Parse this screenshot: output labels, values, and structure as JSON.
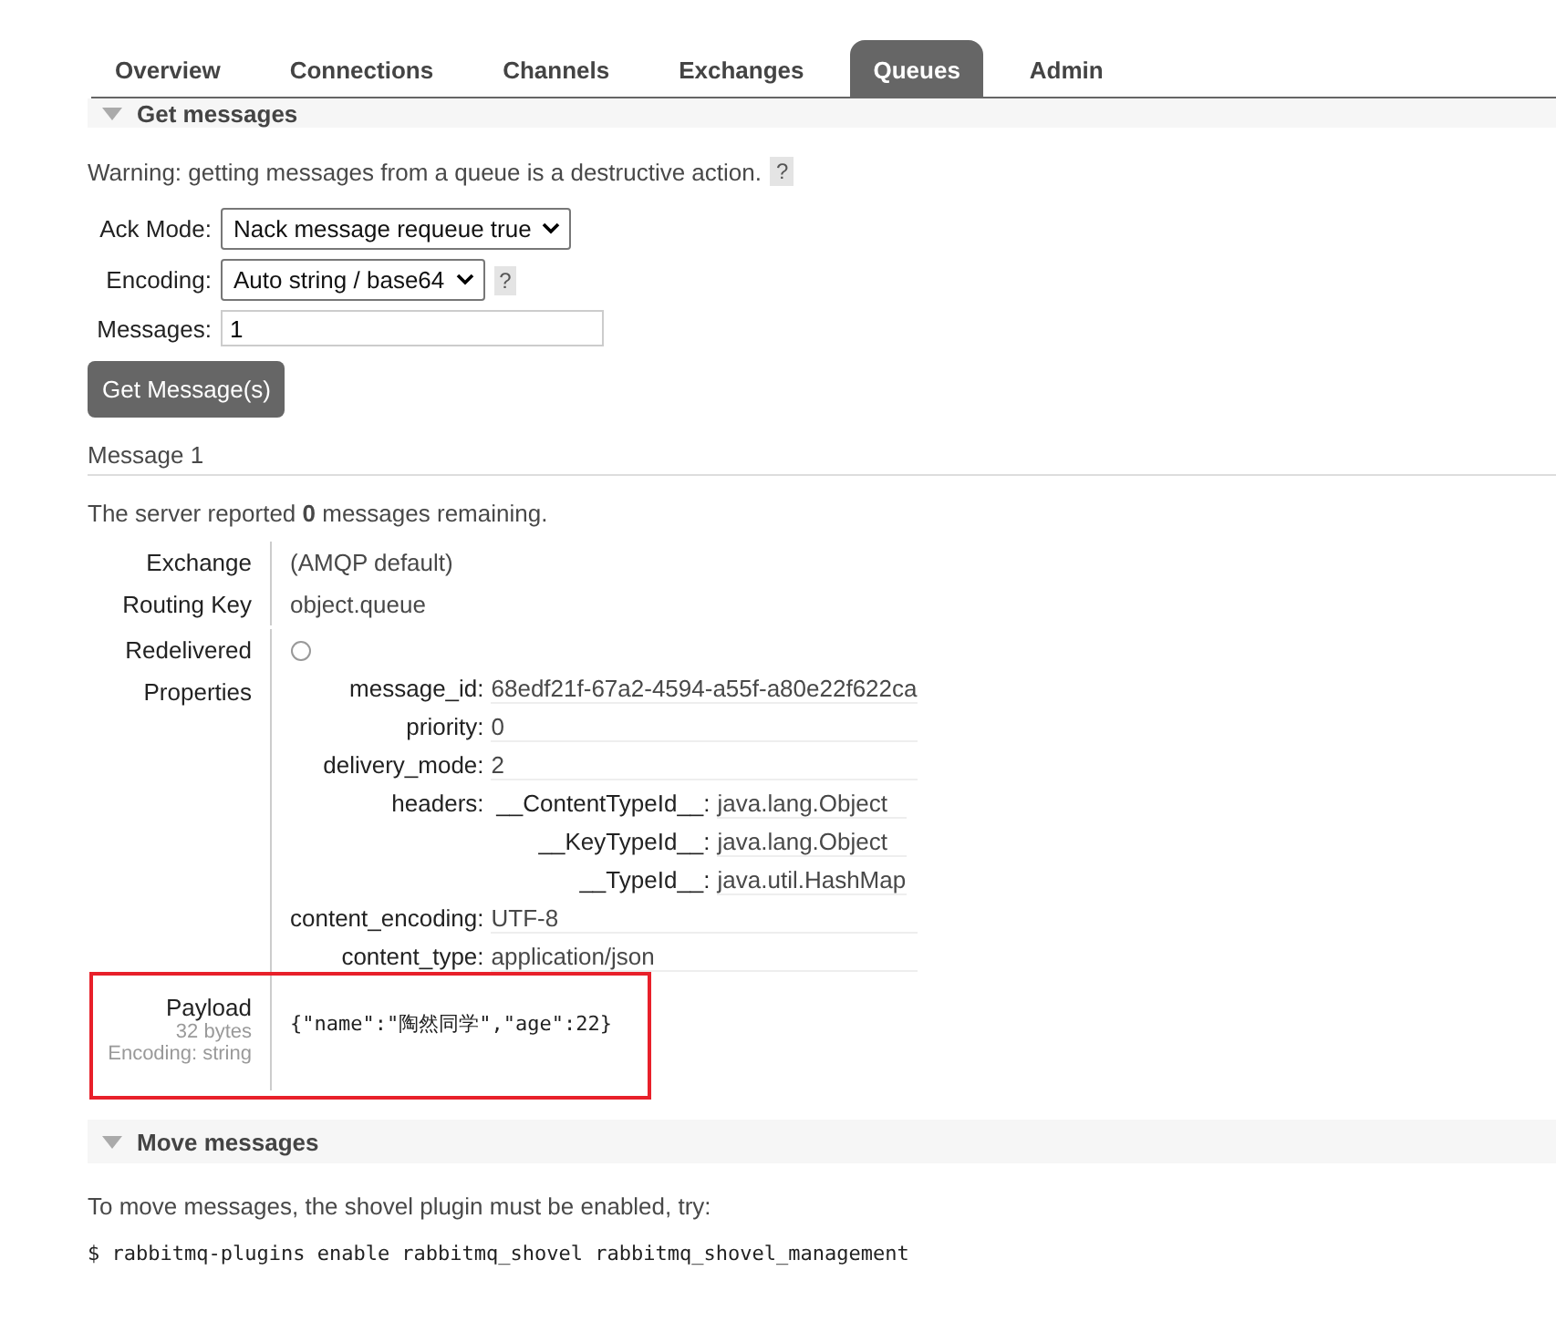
{
  "tabs": [
    {
      "label": "Overview",
      "selected": false
    },
    {
      "label": "Connections",
      "selected": false
    },
    {
      "label": "Channels",
      "selected": false
    },
    {
      "label": "Exchanges",
      "selected": false
    },
    {
      "label": "Queues",
      "selected": true
    },
    {
      "label": "Admin",
      "selected": false
    }
  ],
  "get_messages": {
    "title": "Get messages",
    "warning": "Warning: getting messages from a queue is a destructive action.",
    "warning_help": "?",
    "fields": [
      {
        "kind": "select",
        "label": "Ack Mode:",
        "value": "Nack message requeue true"
      },
      {
        "kind": "select",
        "label": "Encoding:",
        "value": "Auto string / base64",
        "help": "?"
      },
      {
        "kind": "text",
        "label": "Messages:",
        "value": "1"
      }
    ],
    "button": "Get Message(s)",
    "message": {
      "heading": "Message 1",
      "remaining": "The server reported **0** messages remaining.",
      "rows": [
        {
          "kind": "text",
          "label": "Exchange",
          "value": "(AMQP default)"
        },
        {
          "kind": "text",
          "label": "Routing Key",
          "value": "object.queue"
        },
        {
          "kind": "flag",
          "label": "Redelivered",
          "checked": false
        },
        {
          "kind": "properties",
          "label": "Properties",
          "properties": [
            {
              "key": "message_id:",
              "value": "68edf21f-67a2-4594-a55f-a80e22f622ca"
            },
            {
              "key": "priority:",
              "value": "0"
            },
            {
              "key": "delivery_mode:",
              "value": "2"
            },
            {
              "key": "headers:",
              "entries": [
                {
                  "key": "__ContentTypeId__:",
                  "value": "java.lang.Object"
                },
                {
                  "key": "__KeyTypeId__:",
                  "value": "java.lang.Object"
                },
                {
                  "key": "__TypeId__:",
                  "value": "java.util.HashMap"
                }
              ]
            },
            {
              "key": "content_encoding:",
              "value": "UTF-8"
            },
            {
              "key": "content_type:",
              "value": "application/json"
            }
          ]
        },
        {
          "kind": "payload",
          "label": "Payload",
          "size": "32 bytes",
          "encoding": "Encoding: string",
          "value": "{\"name\":\"陶然同学\",\"age\":22}",
          "highlighted": true
        }
      ]
    }
  },
  "move_messages": {
    "title": "Move messages",
    "text": "To move messages, the shovel plugin must be enabled, try:",
    "command": "$ rabbitmq-plugins enable rabbitmq_shovel rabbitmq_shovel_management"
  }
}
